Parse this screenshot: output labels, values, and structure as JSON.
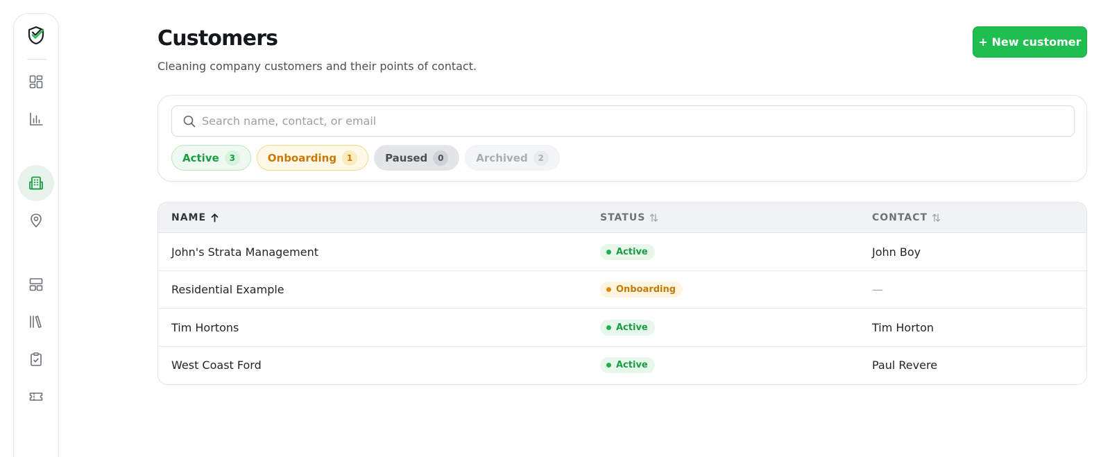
{
  "page": {
    "title": "Customers",
    "subtitle": "Cleaning company customers and their points of contact.",
    "new_button_label": "+ New customer"
  },
  "sidebar": {
    "logo_icon": "shield-check-icon",
    "items": [
      {
        "icon": "dashboard-grid-icon",
        "active": false
      },
      {
        "icon": "bar-chart-icon",
        "active": false
      },
      {
        "icon": "building-icon",
        "active": true
      },
      {
        "icon": "map-pin-icon",
        "active": false
      },
      {
        "icon": "layout-icon",
        "active": false
      },
      {
        "icon": "library-icon",
        "active": false
      },
      {
        "icon": "clipboard-check-icon",
        "active": false
      },
      {
        "icon": "ticket-icon",
        "active": false
      }
    ]
  },
  "search": {
    "placeholder": "Search name, contact, or email",
    "value": ""
  },
  "filters": [
    {
      "label": "Active",
      "count": "3",
      "style": "active"
    },
    {
      "label": "Onboarding",
      "count": "1",
      "style": "onboarding"
    },
    {
      "label": "Paused",
      "count": "0",
      "style": "paused"
    },
    {
      "label": "Archived",
      "count": "2",
      "style": "archived"
    }
  ],
  "table": {
    "columns": [
      {
        "label": "NAME",
        "sort": "ascending"
      },
      {
        "label": "STATUS",
        "sort": "none"
      },
      {
        "label": "CONTACT",
        "sort": "none"
      }
    ],
    "rows": [
      {
        "name": "John's Strata Management",
        "status": "Active",
        "status_style": "active",
        "contact": "John Boy"
      },
      {
        "name": "Residential Example",
        "status": "Onboarding",
        "status_style": "onboarding",
        "contact": "—"
      },
      {
        "name": "Tim Hortons",
        "status": "Active",
        "status_style": "active",
        "contact": "Tim Horton"
      },
      {
        "name": "West Coast Ford",
        "status": "Active",
        "status_style": "active",
        "contact": "Paul Revere"
      }
    ]
  },
  "colors": {
    "accent": "#1fbf4f",
    "active": "#1a9c42",
    "onboarding": "#c67a05",
    "paused": "#4a4f55",
    "archived": "#a9aeb4"
  }
}
